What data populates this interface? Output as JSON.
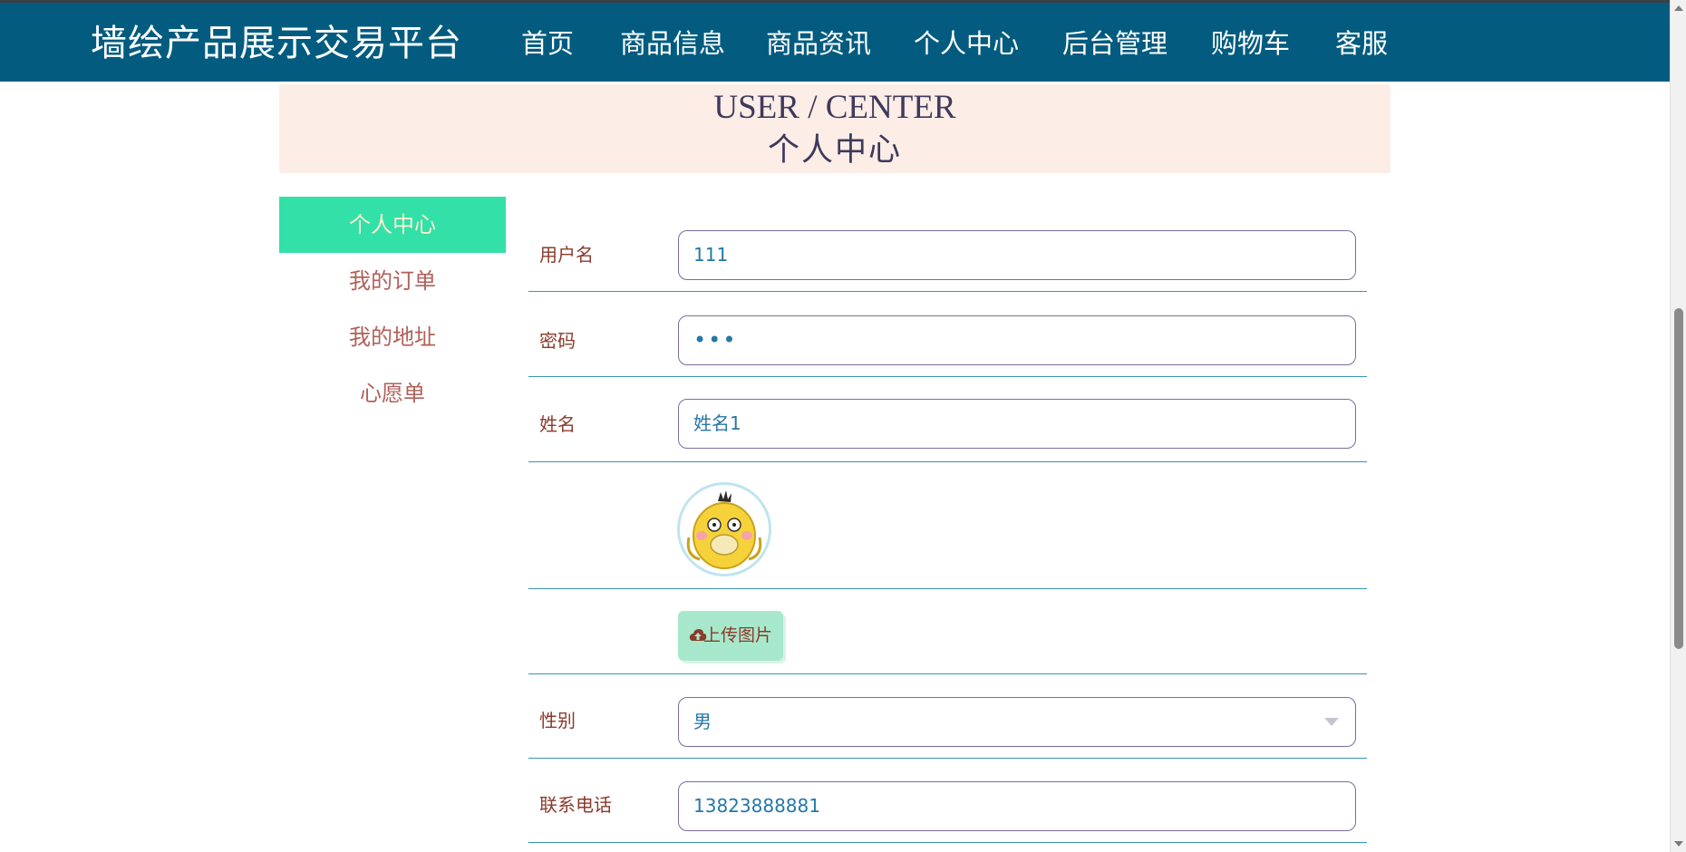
{
  "app": {
    "title": "墙绘产品展示交易平台"
  },
  "nav": {
    "items": [
      {
        "label": "首页"
      },
      {
        "label": "商品信息"
      },
      {
        "label": "商品资讯"
      },
      {
        "label": "个人中心",
        "active": true
      },
      {
        "label": "后台管理"
      },
      {
        "label": "购物车"
      },
      {
        "label": "客服"
      }
    ]
  },
  "banner": {
    "en": "USER / CENTER",
    "cn": "个人中心"
  },
  "sidebar": {
    "items": [
      {
        "label": "个人中心",
        "active": true
      },
      {
        "label": "我的订单"
      },
      {
        "label": "我的地址"
      },
      {
        "label": "心愿单"
      }
    ]
  },
  "form": {
    "username": {
      "label": "用户名",
      "value": "111"
    },
    "password": {
      "label": "密码",
      "value": "•••"
    },
    "name": {
      "label": "姓名",
      "value": "姓名1"
    },
    "avatar": {
      "icon": "psyduck-avatar"
    },
    "upload": {
      "label": "上传图片",
      "icon": "cloud-upload-icon"
    },
    "gender": {
      "label": "性别",
      "value": "男"
    },
    "phone": {
      "label": "联系电话",
      "value": "13823888881"
    }
  },
  "colors": {
    "topbar": "#035c7f",
    "banner_bg": "#fcede7",
    "sidebar_active": "#33e0a8",
    "label_text": "#8a3b2b",
    "input_text": "#2577a8",
    "divider": "#3a93b5",
    "upload_button": "#a7e8cc"
  }
}
